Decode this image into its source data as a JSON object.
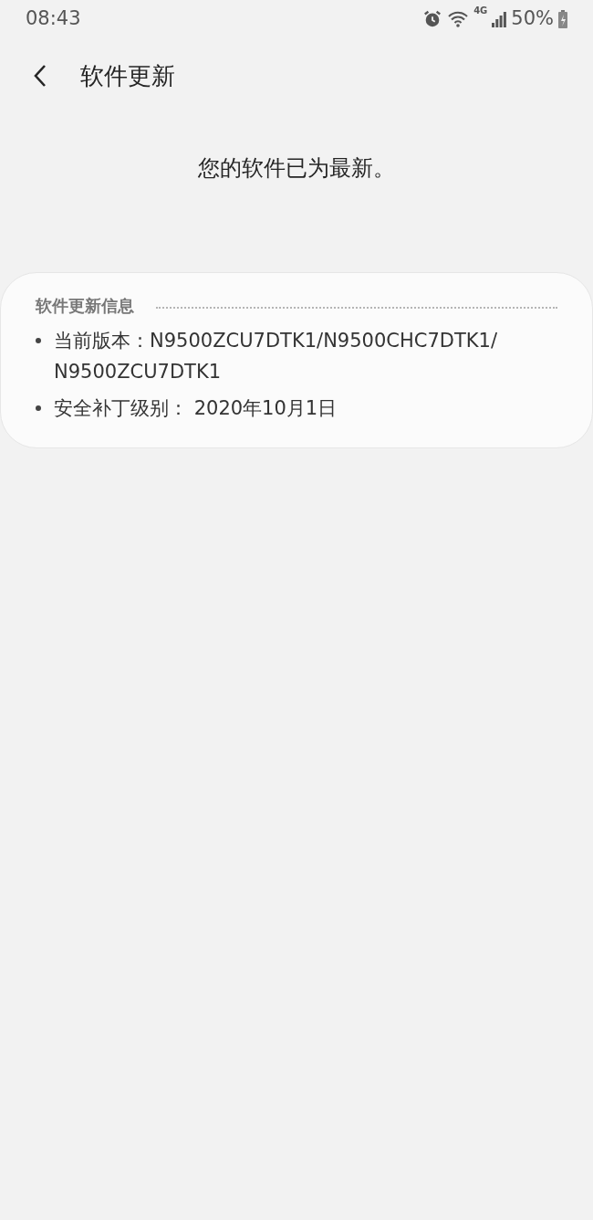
{
  "status_bar": {
    "time": "08:43",
    "network": "4G",
    "battery": "50%"
  },
  "header": {
    "title": "软件更新"
  },
  "message": "您的软件已为最新。",
  "info_card": {
    "title": "软件更新信息",
    "items": [
      {
        "lines": [
          "当前版本：N9500ZCU7DTK1/N9500CHC7DTK1/",
          "N9500ZCU7DTK1"
        ]
      },
      {
        "lines": [
          "安全补丁级别： 2020年10月1日"
        ]
      }
    ]
  }
}
